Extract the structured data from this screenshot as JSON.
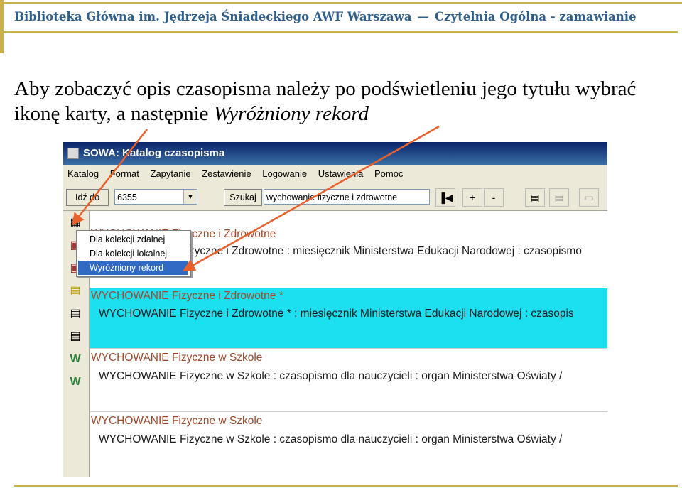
{
  "slide": {
    "org": "Biblioteka Główna im. Jędrzeja Śniadeckiego AWF Warszawa",
    "section": "Czytelnia Ogólna - zamawianie",
    "instruction_1": "Aby zobaczyć opis czasopisma należy po podświetleniu jego tytułu wybrać ikonę karty, a następnie",
    "instruction_em": "Wyróżniony rekord",
    "accent_color": "#c9b24c",
    "header_color": "#2f5f8c"
  },
  "window": {
    "title": "SOWA: Katalog czasopisma",
    "menu": [
      "Katalog",
      "Format",
      "Zapytanie",
      "Zestawienie",
      "Logowanie",
      "Ustawienia",
      "Pomoc"
    ]
  },
  "toolbar": {
    "goto_label": "Idź do",
    "goto_value": "6355",
    "search_label": "Szukaj",
    "search_value": "wychowanie fizyczne i zdrowotne",
    "plus_label": "+",
    "minus_label": "-"
  },
  "context_menu": {
    "items": [
      "Dla kolekcji zdalnej",
      "Dla kolekcji lokalnej",
      "Wyróżniony rekord"
    ],
    "highlighted_index": 2
  },
  "records": [
    {
      "heading": "WYCHOWANIE Fizyczne i Zdrowotne",
      "detail": "WYCHOWANIE Fizyczne i Zdrowotne  :  miesięcznik Ministerstwa Edukacji Narodowej  :  czasopismo"
    },
    {
      "heading": "WYCHOWANIE Fizyczne i Zdrowotne *",
      "detail": "WYCHOWANIE Fizyczne i Zdrowotne *  :  miesięcznik Ministerstwa Edukacji Narodowej  :  czasopis",
      "selected": true
    },
    {
      "heading": "WYCHOWANIE Fizyczne w Szkole",
      "detail": "WYCHOWANIE Fizyczne w Szkole  :  czasopismo dla nauczycieli  :  organ Ministerstwa Oświaty  /"
    },
    {
      "heading": "WYCHOWANIE Fizyczne w Szkole",
      "detail": "WYCHOWANIE Fizyczne w Szkole  :  czasopismo dla nauczycieli  :  organ Ministerstwa Oświaty  /"
    }
  ],
  "highlight_color": "#1ce0f0",
  "arrow_color": "#e8602c"
}
